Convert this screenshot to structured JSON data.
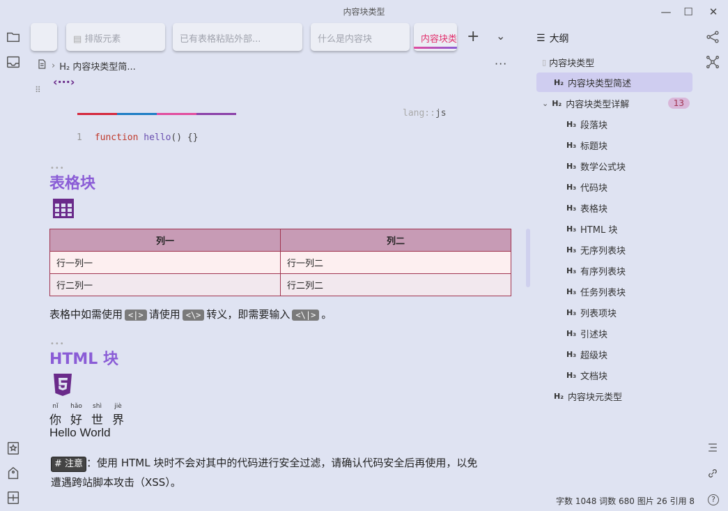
{
  "window": {
    "title": "内容块类型"
  },
  "tabs": [
    {
      "label": "排版元素"
    },
    {
      "label": "已有表格粘贴外部..."
    },
    {
      "label": "什么是内容块"
    },
    {
      "label": "内容块类"
    }
  ],
  "breadcrumb": {
    "heading": "H₂ 内容块类型简..."
  },
  "code": {
    "lang_prefix": "lang::",
    "lang": "js",
    "line_no": "1",
    "keyword": "function",
    "fn": "hello",
    "rest": "() {}"
  },
  "table_section": {
    "title": "表格块",
    "headers": [
      "列一",
      "列二"
    ],
    "rows": [
      [
        "行一列一",
        "行一列二"
      ],
      [
        "行二列一",
        "行二列二"
      ]
    ],
    "note_a": "表格中如需使用",
    "kbd1": "<|>",
    "note_b": "请使用",
    "kbd2": "<\\>",
    "note_c": "转义，即需要输入",
    "kbd3": "<\\|>",
    "note_d": "。"
  },
  "html_section": {
    "title": "HTML 块",
    "ruby": [
      {
        "char": "你",
        "py": "nǐ"
      },
      {
        "char": "好",
        "py": "hǎo"
      },
      {
        "char": "世",
        "py": "shì"
      },
      {
        "char": "界",
        "py": "jiè"
      }
    ],
    "hello": "Hello World",
    "tag": "注意",
    "warning_1": "：使用 HTML 块时不会对其中的代码进行安全过滤，请确认代码安全后再使用，以免",
    "warning_2": "遭遇跨站脚本攻击（XSS）。"
  },
  "outline": {
    "title": "大纲",
    "root": "内容块类型",
    "items": [
      {
        "level": "H₂",
        "label": "内容块类型简述"
      },
      {
        "level": "H₂",
        "label": "内容块类型详解",
        "badge": "13"
      },
      {
        "level": "H₃",
        "label": "段落块"
      },
      {
        "level": "H₃",
        "label": "标题块"
      },
      {
        "level": "H₃",
        "label": "数学公式块"
      },
      {
        "level": "H₃",
        "label": "代码块"
      },
      {
        "level": "H₃",
        "label": "表格块"
      },
      {
        "level": "H₃",
        "label": "HTML 块"
      },
      {
        "level": "H₃",
        "label": "无序列表块"
      },
      {
        "level": "H₃",
        "label": "有序列表块"
      },
      {
        "level": "H₃",
        "label": "任务列表块"
      },
      {
        "level": "H₃",
        "label": "列表项块"
      },
      {
        "level": "H₃",
        "label": "引述块"
      },
      {
        "level": "H₃",
        "label": "超级块"
      },
      {
        "level": "H₃",
        "label": "文档块"
      },
      {
        "level": "H₂",
        "label": "内容块元类型"
      }
    ]
  },
  "status": {
    "text": "字数 1048  词数 680  图片 26  引用 8"
  },
  "colors": {
    "accent": "#8a5cd6",
    "table_border": "#a0334f",
    "table_header": "#c79bb5",
    "tab_active": "#e1306c"
  }
}
